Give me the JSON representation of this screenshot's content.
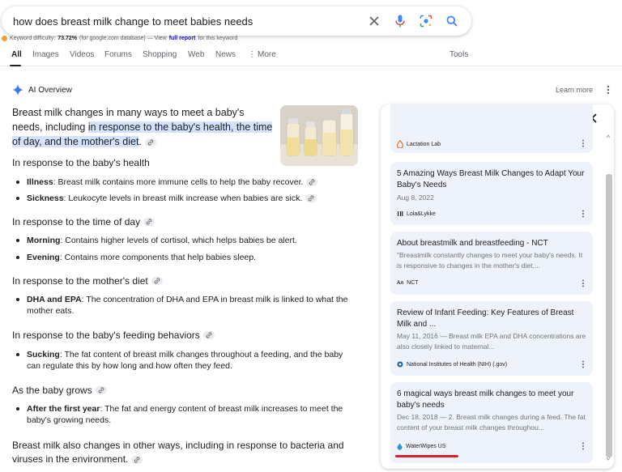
{
  "search": {
    "query": "how does breast milk change to meet babies needs"
  },
  "keyword_line": {
    "prefix": "Keyword difficulty:",
    "value": "73.72%",
    "mid": "(for google.com database) — View",
    "link": "full report",
    "suffix": "for this keyword"
  },
  "tabs": {
    "all": "All",
    "images": "Images",
    "videos": "Videos",
    "forums": "Forums",
    "shopping": "Shopping",
    "web": "Web",
    "news": "News",
    "more": "More",
    "tools": "Tools"
  },
  "ai_overview": {
    "title": "AI Overview",
    "learn_more": "Learn more",
    "intro_plain": "Breast milk changes in many ways to meet a baby's needs, including ",
    "intro_highlight": "in response to the baby's health, the time of day, and the mother's diet",
    "intro_end": "."
  },
  "sections": [
    {
      "heading": "In response to the baby's health",
      "bullets": [
        {
          "term": "Illness",
          "text": ": Breast milk contains more immune cells to help the baby recover."
        },
        {
          "term": "Sickness",
          "text": ": Leukocyte levels in breast milk increase when babies are sick."
        }
      ]
    },
    {
      "heading": "In response to the time of day",
      "bullets": [
        {
          "term": "Morning",
          "text": ": Contains higher levels of cortisol, which helps babies be alert."
        },
        {
          "term": "Evening",
          "text": ": Contains more components that help babies sleep."
        }
      ]
    },
    {
      "heading": "In response to the mother's diet",
      "bullets": [
        {
          "term": "DHA and EPA",
          "text": ": The concentration of DHA and EPA in breast milk is linked to what the mother eats."
        }
      ]
    },
    {
      "heading": "In response to the baby's feeding behaviors",
      "bullets": [
        {
          "term": "Sucking",
          "text": ": The fat content of breast milk changes throughout a feeding, and the baby can regulate this by how long and how often they feed."
        }
      ]
    },
    {
      "heading": "As the baby grows",
      "bullets": [
        {
          "term": "After the first year",
          "text": ": The fat and energy content of breast milk increases to meet the baby's growing needs."
        }
      ]
    }
  ],
  "closing": "Breast milk also changes in other ways, including in response to bacteria and viruses in the environment.",
  "sources": [
    {
      "title": "",
      "date": "",
      "snippet": "",
      "source": "Lactation Lab"
    },
    {
      "title": "5 Amazing Ways Breast Milk Changes to Adapt Your Baby's Needs",
      "date": "Aug 8, 2022",
      "snippet": "",
      "source": "Lola&Lykke"
    },
    {
      "title": "About breastmilk and breastfeeding - NCT",
      "date": "",
      "snippet": "\"Breastmilk constantly changes to meet your baby's needs. It is responsive to changes in the mother's diet,...",
      "source": "NCT"
    },
    {
      "title": "Review of Infant Feeding: Key Features of Breast Milk and ...",
      "date": "May 11, 2016",
      "snippet": " — Breast milk EPA and DHA concentrations are also closely linked to maternal...",
      "source": "National Institutes of Health (NIH) (.gov)"
    },
    {
      "title": "6 magical ways breast milk changes to meet your baby's needs",
      "date": "Dec 18, 2018",
      "snippet": " — 2. Breast milk changes during a feed. The fat content of your breast milk changes throughou...",
      "source": "WaterWipes US"
    }
  ],
  "colors": {
    "highlight": "#d3e3fd",
    "card_bg": "#eef3fb",
    "link": "#1a0dab",
    "annotation_red": "#d6202b"
  }
}
